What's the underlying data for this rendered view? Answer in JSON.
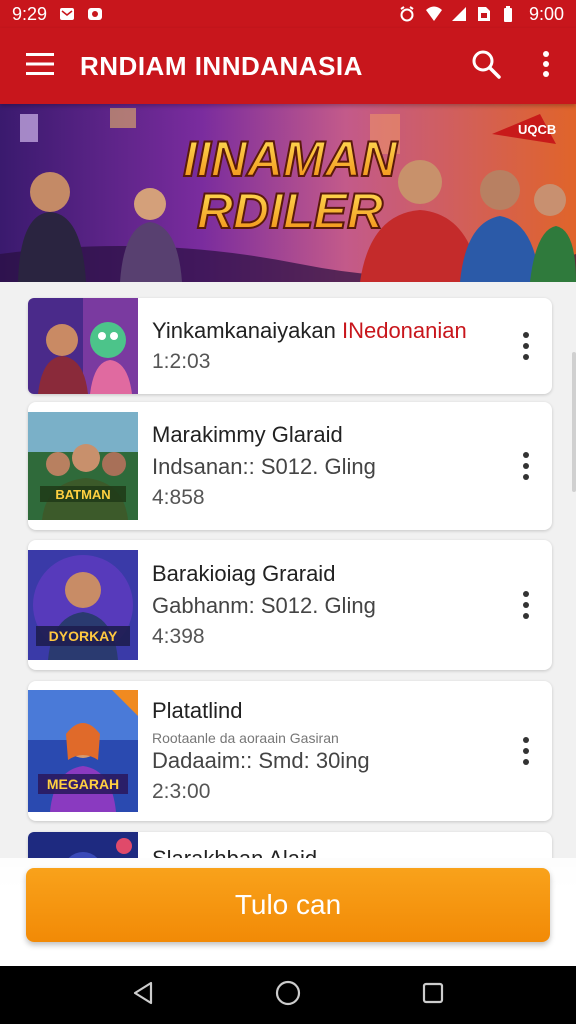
{
  "status_bar": {
    "time": "9:29",
    "clock": "9:00"
  },
  "app_bar": {
    "title": "RNDIAM INNDANASIA"
  },
  "banner": {
    "line1": "IINAMAN",
    "line2": "RDILER",
    "flag_text": "UQCB"
  },
  "items": [
    {
      "title": "Yinkamkanaiyakan ",
      "title_highlight": "INedonanian",
      "subtitle": "",
      "time": "1:2:03",
      "thumb": "purple"
    },
    {
      "title": "Marakimmy Glaraid",
      "subtitle": "Indsanan:: S012. Gling",
      "time": "4:858",
      "thumb": "green",
      "badge": "BATMAN"
    },
    {
      "title": "Barakioiag Graraid",
      "subtitle": "Gabhanm: S012. Gling",
      "time": "4:398",
      "thumb": "blue",
      "badge": "DYORKAY"
    },
    {
      "title": "Platatlind",
      "note": "Rootaanle da aoraain Gasiran",
      "subtitle": "Dadaaim:: Smd: 30ing",
      "time": "2:3:00",
      "thumb": "orange",
      "badge": "MEGARAH"
    },
    {
      "title": "Slarakhban Alaid",
      "subtitle": "",
      "time": "",
      "thumb": "navy"
    }
  ],
  "cta": {
    "label": "Tulo can"
  },
  "colors": {
    "primary": "#c8161c",
    "accent": "#f59416"
  }
}
